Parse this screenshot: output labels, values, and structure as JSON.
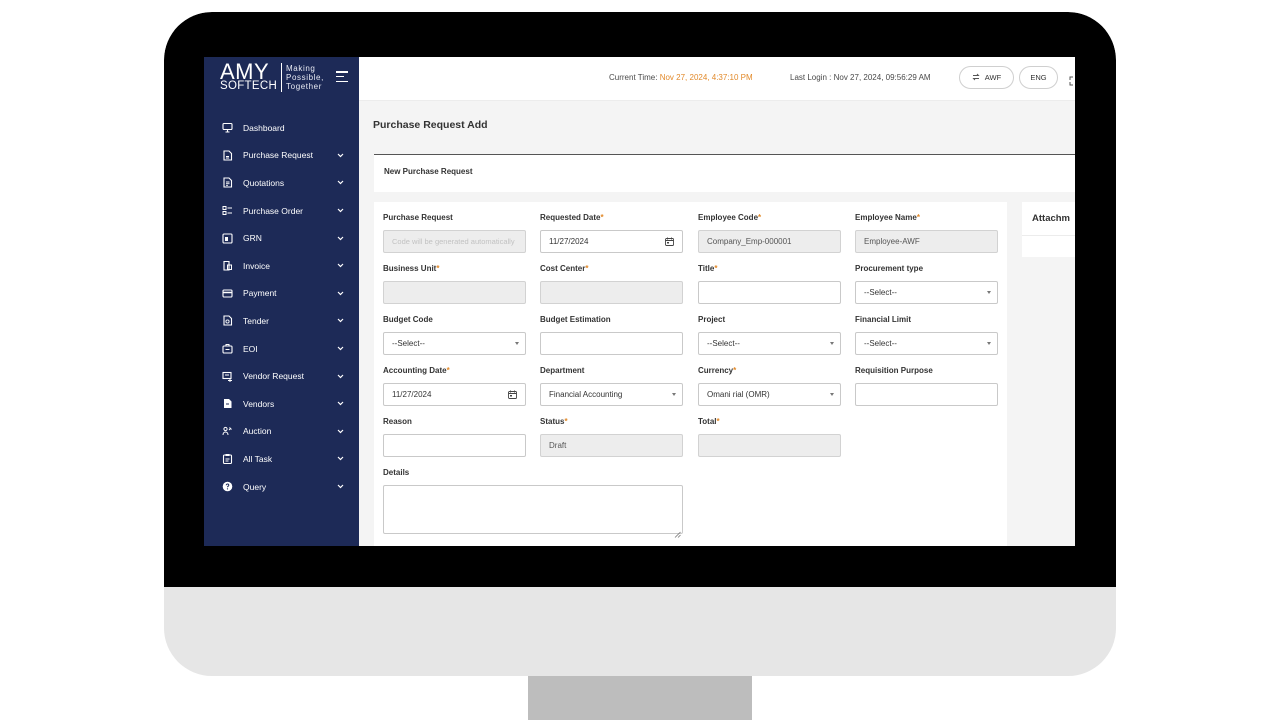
{
  "brand": {
    "name_top": "AMY",
    "name_bottom": "SOFTECH",
    "tagline_1": "Making",
    "tagline_2": "Possible,",
    "tagline_3": "Together"
  },
  "sidebar": {
    "items": [
      {
        "label": "Dashboard",
        "icon": "monitor-icon",
        "has_chevron": false
      },
      {
        "label": "Purchase Request",
        "icon": "document-icon",
        "has_chevron": true
      },
      {
        "label": "Quotations",
        "icon": "file-text-icon",
        "has_chevron": true
      },
      {
        "label": "Purchase Order",
        "icon": "list-icon",
        "has_chevron": true
      },
      {
        "label": "GRN",
        "icon": "receipt-icon",
        "has_chevron": true
      },
      {
        "label": "Invoice",
        "icon": "invoice-icon",
        "has_chevron": true
      },
      {
        "label": "Payment",
        "icon": "credit-card-icon",
        "has_chevron": true
      },
      {
        "label": "Tender",
        "icon": "tender-icon",
        "has_chevron": true
      },
      {
        "label": "EOI",
        "icon": "briefcase-icon",
        "has_chevron": true
      },
      {
        "label": "Vendor Request",
        "icon": "vendor-request-icon",
        "has_chevron": true
      },
      {
        "label": "Vendors",
        "icon": "vendors-icon",
        "has_chevron": true
      },
      {
        "label": "Auction",
        "icon": "auction-icon",
        "has_chevron": true
      },
      {
        "label": "All Task",
        "icon": "clipboard-icon",
        "has_chevron": true
      },
      {
        "label": "Query",
        "icon": "help-icon",
        "has_chevron": true
      }
    ]
  },
  "topbar": {
    "current_time_label": "Current Time:",
    "current_time_value": "Nov 27, 2024, 4:37:10 PM",
    "last_login_label": "Last Login :",
    "last_login_value": "Nov 27, 2024, 09:56:29 AM",
    "switch_label": "AWF",
    "language_label": "ENG"
  },
  "page": {
    "title": "Purchase Request Add",
    "card_title": "New Purchase Request",
    "attachments_title": "Attachm"
  },
  "form": {
    "purchase_request": {
      "label": "Purchase Request",
      "placeholder": "Code will be generated automatically"
    },
    "requested_date": {
      "label": "Requested Date",
      "value": "11/27/2024"
    },
    "employee_code": {
      "label": "Employee Code",
      "value": "Company_Emp-000001"
    },
    "employee_name": {
      "label": "Employee Name",
      "value": "Employee-AWF"
    },
    "business_unit": {
      "label": "Business Unit",
      "value": ""
    },
    "cost_center": {
      "label": "Cost Center",
      "value": ""
    },
    "title": {
      "label": "Title",
      "value": ""
    },
    "procurement_type": {
      "label": "Procurement type",
      "value": "--Select--"
    },
    "budget_code": {
      "label": "Budget Code",
      "value": "--Select--"
    },
    "budget_estimation": {
      "label": "Budget Estimation",
      "value": ""
    },
    "project": {
      "label": "Project",
      "value": "--Select--"
    },
    "financial_limit": {
      "label": "Financial Limit",
      "value": "--Select--"
    },
    "accounting_date": {
      "label": "Accounting Date",
      "value": "11/27/2024"
    },
    "department": {
      "label": "Department",
      "value": "Financial Accounting"
    },
    "currency": {
      "label": "Currency",
      "value": "Omani rial (OMR)"
    },
    "requisition_purpose": {
      "label": "Requisition Purpose",
      "value": ""
    },
    "reason": {
      "label": "Reason",
      "value": ""
    },
    "status": {
      "label": "Status",
      "value": "Draft"
    },
    "total": {
      "label": "Total",
      "value": ""
    },
    "details": {
      "label": "Details",
      "value": ""
    },
    "required_mark": "*"
  },
  "colors": {
    "sidebar_bg": "#1d2a57",
    "accent": "#e28a2b"
  }
}
